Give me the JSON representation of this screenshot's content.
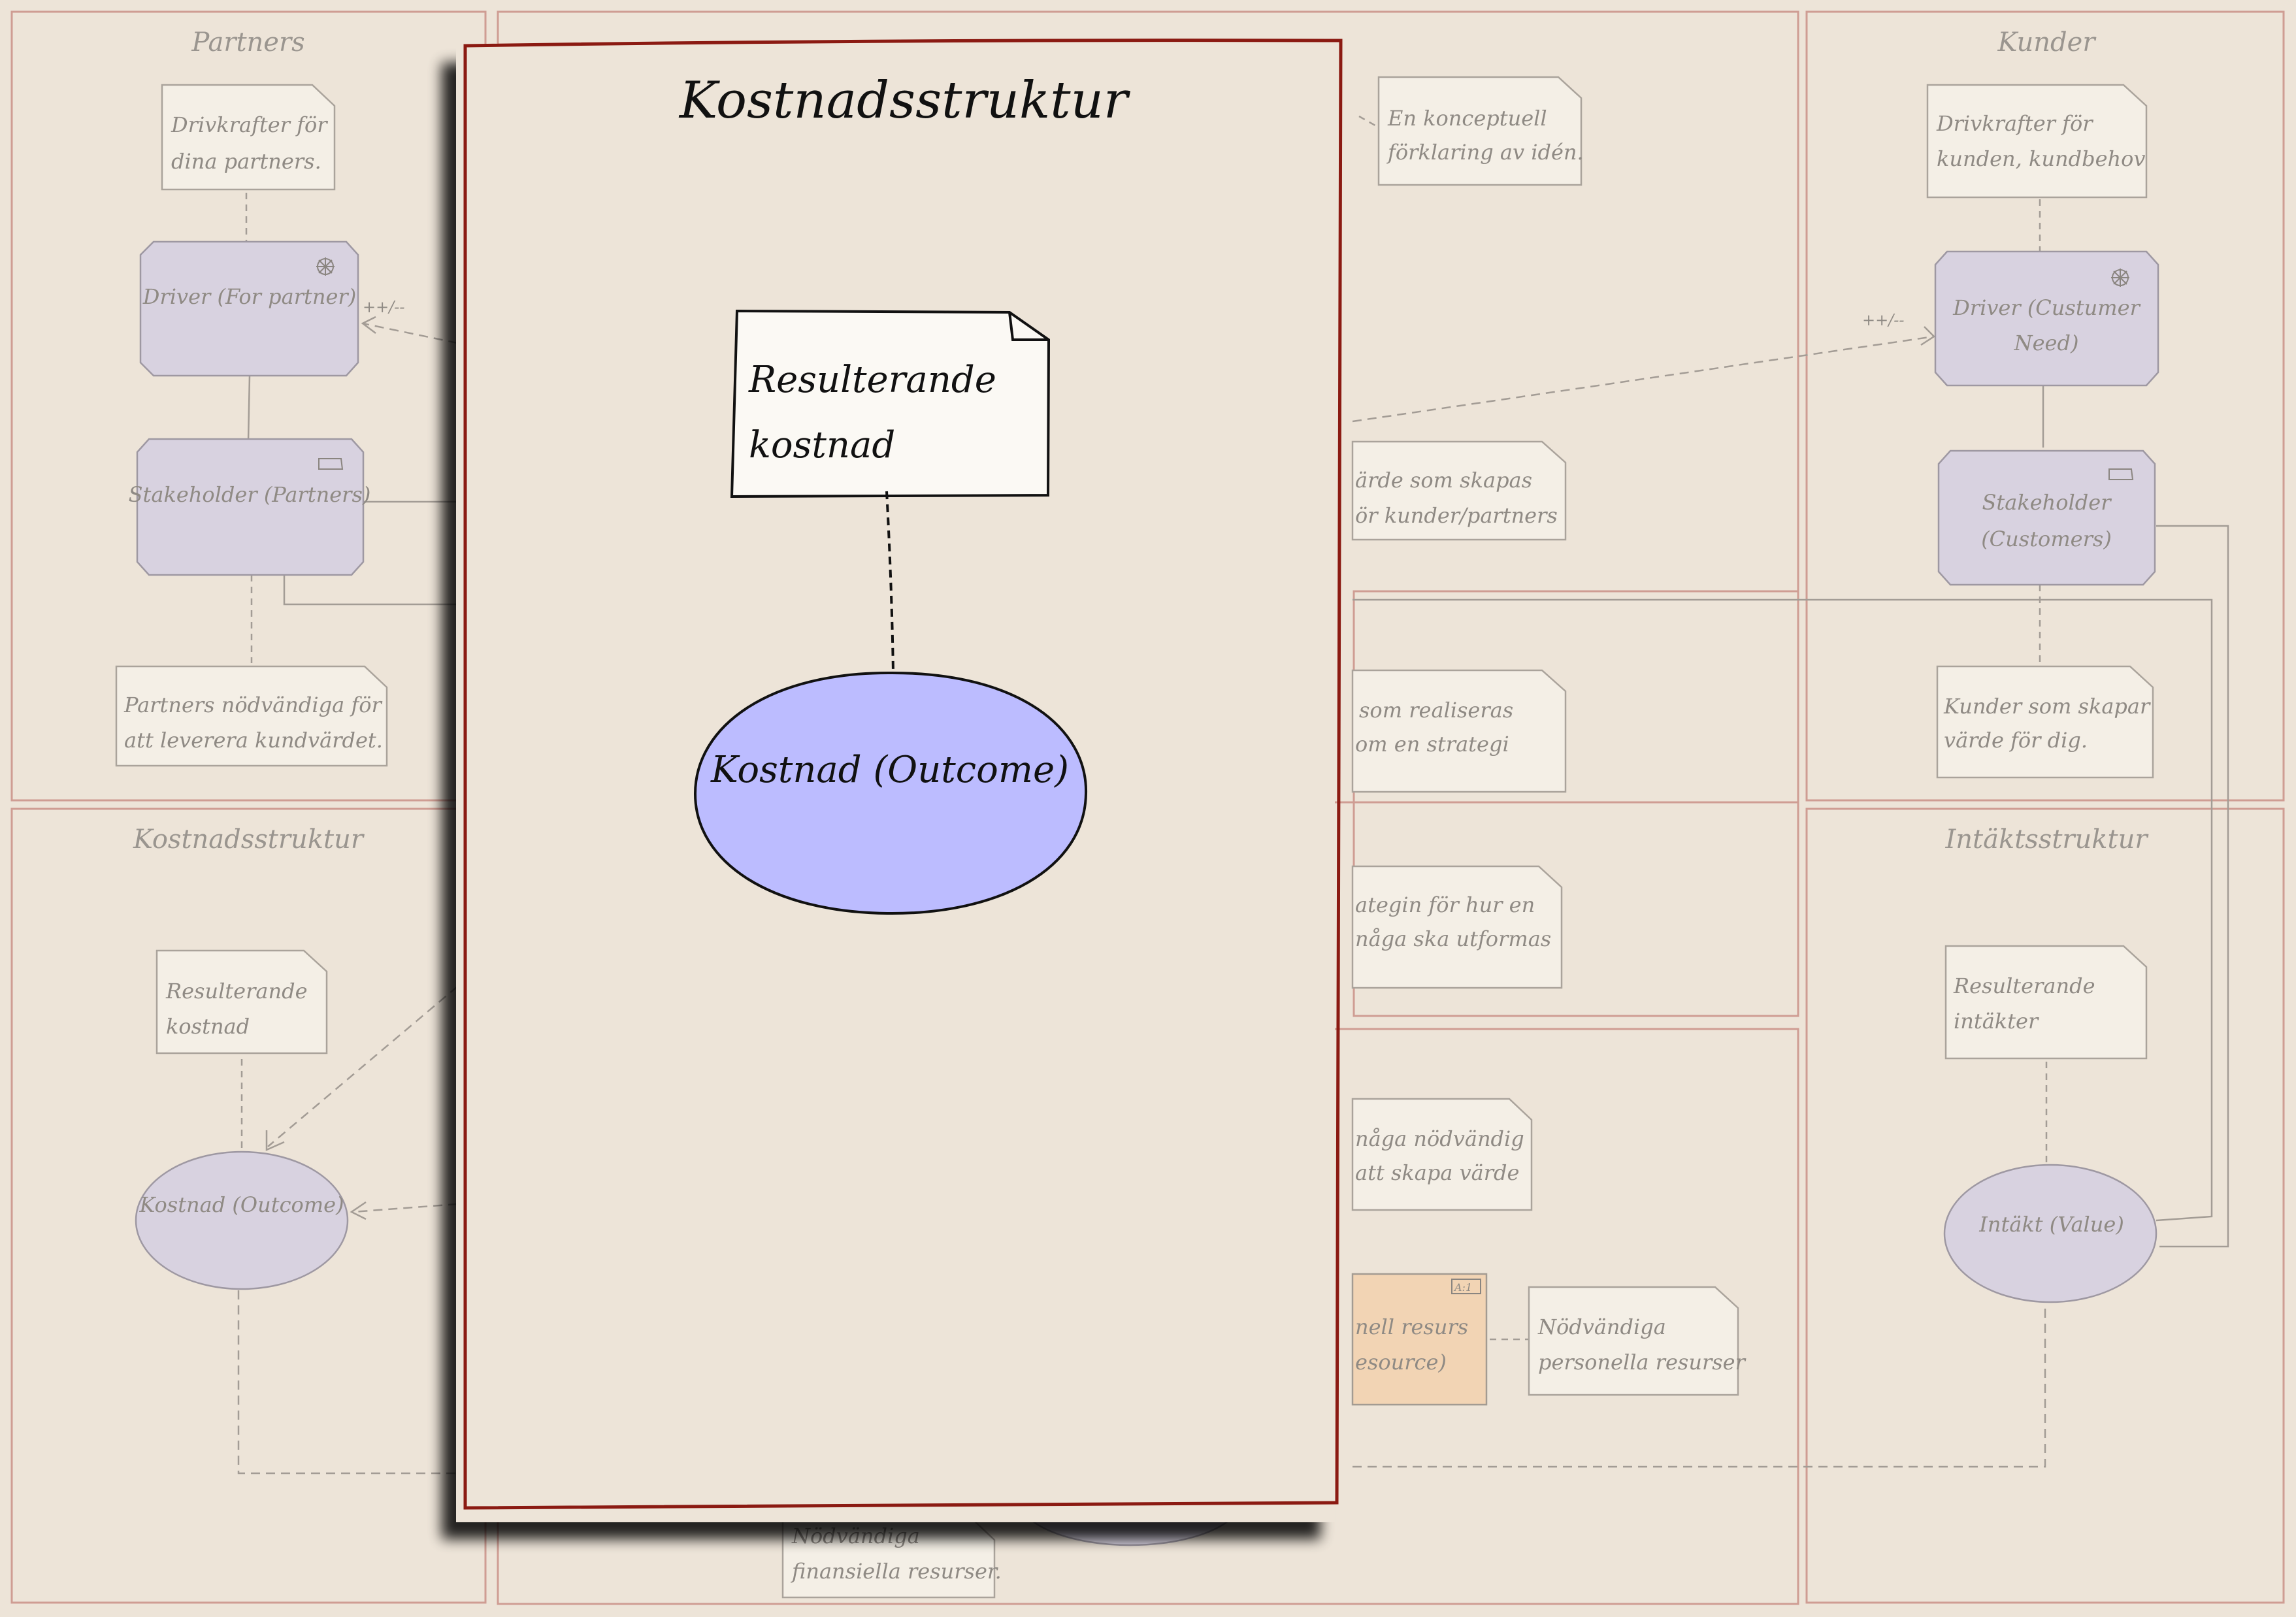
{
  "background": {
    "panels": {
      "partners": "Partners",
      "customers": "Kunder",
      "cost_structure": "Kostnadsstruktur",
      "revenue_structure": "Intäktsstruktur"
    },
    "notes": {
      "partner_drivers": [
        "Drivkrafter för",
        "dina partners."
      ],
      "partner_necessary": [
        "Partners nödvändiga för",
        "att leverera kundvärdet."
      ],
      "concept": [
        "En konceptuell",
        "förklaring av idén."
      ],
      "value_created": [
        "ärde som skapas",
        "ör kunder/partners"
      ],
      "value_realized": [
        "som realiseras",
        "om en strategi"
      ],
      "strategy": [
        "ategin för hur en",
        "någa ska utformas"
      ],
      "capability": [
        "någa nödvändig",
        "att skapa värde"
      ],
      "personal_resources": [
        "Nödvändiga",
        "personella resurser"
      ],
      "financial_resources": [
        "Nödvändiga",
        "finansiella resurser."
      ],
      "customer_drivers": [
        "Drivkrafter för",
        "kunden, kundbehov"
      ],
      "customers_value": [
        "Kunder som skapar",
        "värde för dig."
      ],
      "cost_resulting": [
        "Resulterande",
        "kostnad"
      ],
      "revenue_resulting": [
        "Resulterande",
        "intäkter"
      ]
    },
    "elements": {
      "driver_partner": [
        "Driver (For partner)"
      ],
      "stakeholder_partners": [
        "Stakeholder (Partners)"
      ],
      "driver_customer": [
        "Driver (Custumer",
        "Need)"
      ],
      "stakeholder_customers": [
        "Stakeholder",
        "(Customers)"
      ],
      "cost_outcome": [
        "Kostnad (Outcome)"
      ],
      "revenue_value": [
        "Intäkt (Value)"
      ],
      "personal_resource": [
        "nell resurs",
        "esource)"
      ]
    },
    "relation_labels": {
      "influence_left": "++/--",
      "influence_right": "++/--"
    },
    "resource_badge": "A:1"
  },
  "popup": {
    "title": "Kostnadsstruktur",
    "note_lines": [
      "Resulterande",
      "kostnad"
    ],
    "outcome_label": "Kostnad (Outcome)"
  },
  "colors": {
    "background": "#ede4d8",
    "panel_border": "#c99a90",
    "popup_border": "#8b1a12",
    "element_fill": "#d8d2e0",
    "outcome_fill": "#bcbcff",
    "resource_fill": "#f2d4b4",
    "note_fill": "#f4efe6"
  }
}
